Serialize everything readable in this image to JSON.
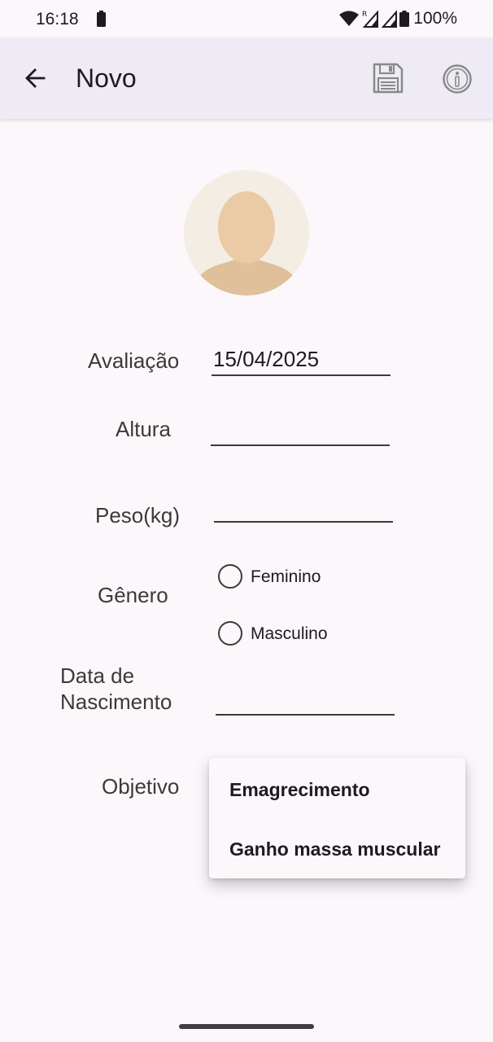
{
  "status_bar": {
    "time": "16:18",
    "battery_percent": "100%"
  },
  "app_bar": {
    "title": "Novo",
    "icons": [
      "back-arrow-icon",
      "floppy-disk-icon",
      "info-circle-icon"
    ]
  },
  "form": {
    "avaliacao": {
      "label": "Avaliação",
      "value": "15/04/2025"
    },
    "altura": {
      "label": "Altura",
      "value": ""
    },
    "peso": {
      "label": "Peso(kg)",
      "value": ""
    },
    "genero": {
      "label": "Gênero",
      "options": [
        "Feminino",
        "Masculino"
      ]
    },
    "data_nascimento": {
      "label_line1": "Data de",
      "label_line2": "Nascimento",
      "value": ""
    },
    "objetivo": {
      "label": "Objetivo",
      "options": [
        "Emagrecimento",
        "Ganho massa muscular"
      ]
    }
  },
  "colors": {
    "background": "#fcf7fb",
    "app_bar": "#efebf4",
    "text": "#1d1b20"
  }
}
